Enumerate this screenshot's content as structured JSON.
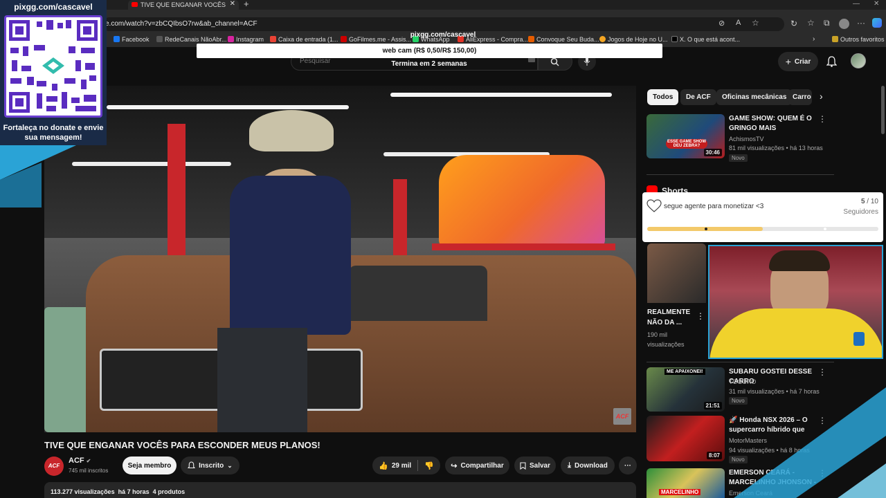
{
  "browser": {
    "tab_title": "TIVE QUE ENGANAR VOCÊS",
    "url": "e.com/watch?v=zbCQIbsO7rw&ab_channel=ACF",
    "bookmarks": [
      {
        "label": "Facebook",
        "color": "#1877f2"
      },
      {
        "label": "RedeCanais NãoAbr...",
        "color": "#555"
      },
      {
        "label": "Instagram",
        "color": "#d6249f"
      },
      {
        "label": "Caixa de entrada (1...",
        "color": "#ea4335"
      },
      {
        "label": "GoFilmes.me - Assis...",
        "color": "#c00"
      },
      {
        "label": "WhatsApp",
        "color": "#25d366"
      },
      {
        "label": "AliExpress - Compra...",
        "color": "#e43225"
      },
      {
        "label": "Convoque Seu Buda...",
        "color": "#e65c00"
      },
      {
        "label": "Jogos de Hoje no U...",
        "color": "#f5a623"
      },
      {
        "label": "X. O que está acont...",
        "color": "#000"
      }
    ],
    "favorites_label": "Outros favoritos"
  },
  "overlay": {
    "brand": "pixgg.com/cascavel",
    "qr_caption": "Fortaleça no donate e envie sua mensagem!",
    "banner_brand": "pixgg.com/cascavel",
    "banner_line1": "web cam (R$ 0,50/R$ 150,00)",
    "banner_line2": "Termina em 2 semanas",
    "goal_text": "segue agente para monetizar <3",
    "goal_current": "5",
    "goal_sep": " / ",
    "goal_total": "10",
    "goal_unit": "Seguidores",
    "goal_progress": 0.5
  },
  "youtube": {
    "search_placeholder": "Pesquisar",
    "create_label": "Criar",
    "video_title": "TIVE QUE ENGANAR VOCÊS PARA ESCONDER MEUS PLANOS!",
    "video_watermark": "ACF",
    "channel_name": "ACF",
    "subscribers": "745 mil inscritos",
    "member_label": "Seja membro",
    "subscribed_label": "Inscrito",
    "likes": "29 mil",
    "share_label": "Compartilhar",
    "save_label": "Salvar",
    "download_label": "Download",
    "description_meta": "113.277 visualizações  há 7 horas  4 produtos"
  },
  "chips": [
    "Todos",
    "De ACF",
    "Oficinas mecânicas",
    "Carro"
  ],
  "recommendations": [
    {
      "title": "GAME SHOW: QUEM É O GRINGO MAIS BRASILEIRO? | ...",
      "channel": "AchismosTV",
      "meta": "81 mil visualizações • há 13 horas",
      "badge": "Novo",
      "duration": "30:46",
      "thumb_text": "ESSE GAME SHOW DEU ZEBRA?"
    },
    {
      "title": "SUBARU GOSTEI DESSE CARRO",
      "channel": "TOGURO",
      "meta": "31 mil visualizações • há 7 horas",
      "badge": "Novo",
      "duration": "21:51",
      "thumb_text": "ME APAIXONEI!"
    },
    {
      "title": "🚀 Honda NSX 2026 – O supercarro híbrido que DESTR...",
      "channel": "MotorMasters",
      "meta": "94 visualizações • há 8 horas",
      "badge": "Novo",
      "duration": "8:07",
      "thumb_text": ""
    },
    {
      "title": "EMERSON CEARÁ - MARCELINHO JHONSON - ...",
      "channel": "Emerson Ceará",
      "meta": "",
      "badge": "",
      "duration": "",
      "thumb_text": "MARCELINHO"
    }
  ],
  "shorts": {
    "heading": "Shorts",
    "item_title": "REALMENTE NÃO DA ...",
    "item_views": "190 mil visualizações"
  }
}
